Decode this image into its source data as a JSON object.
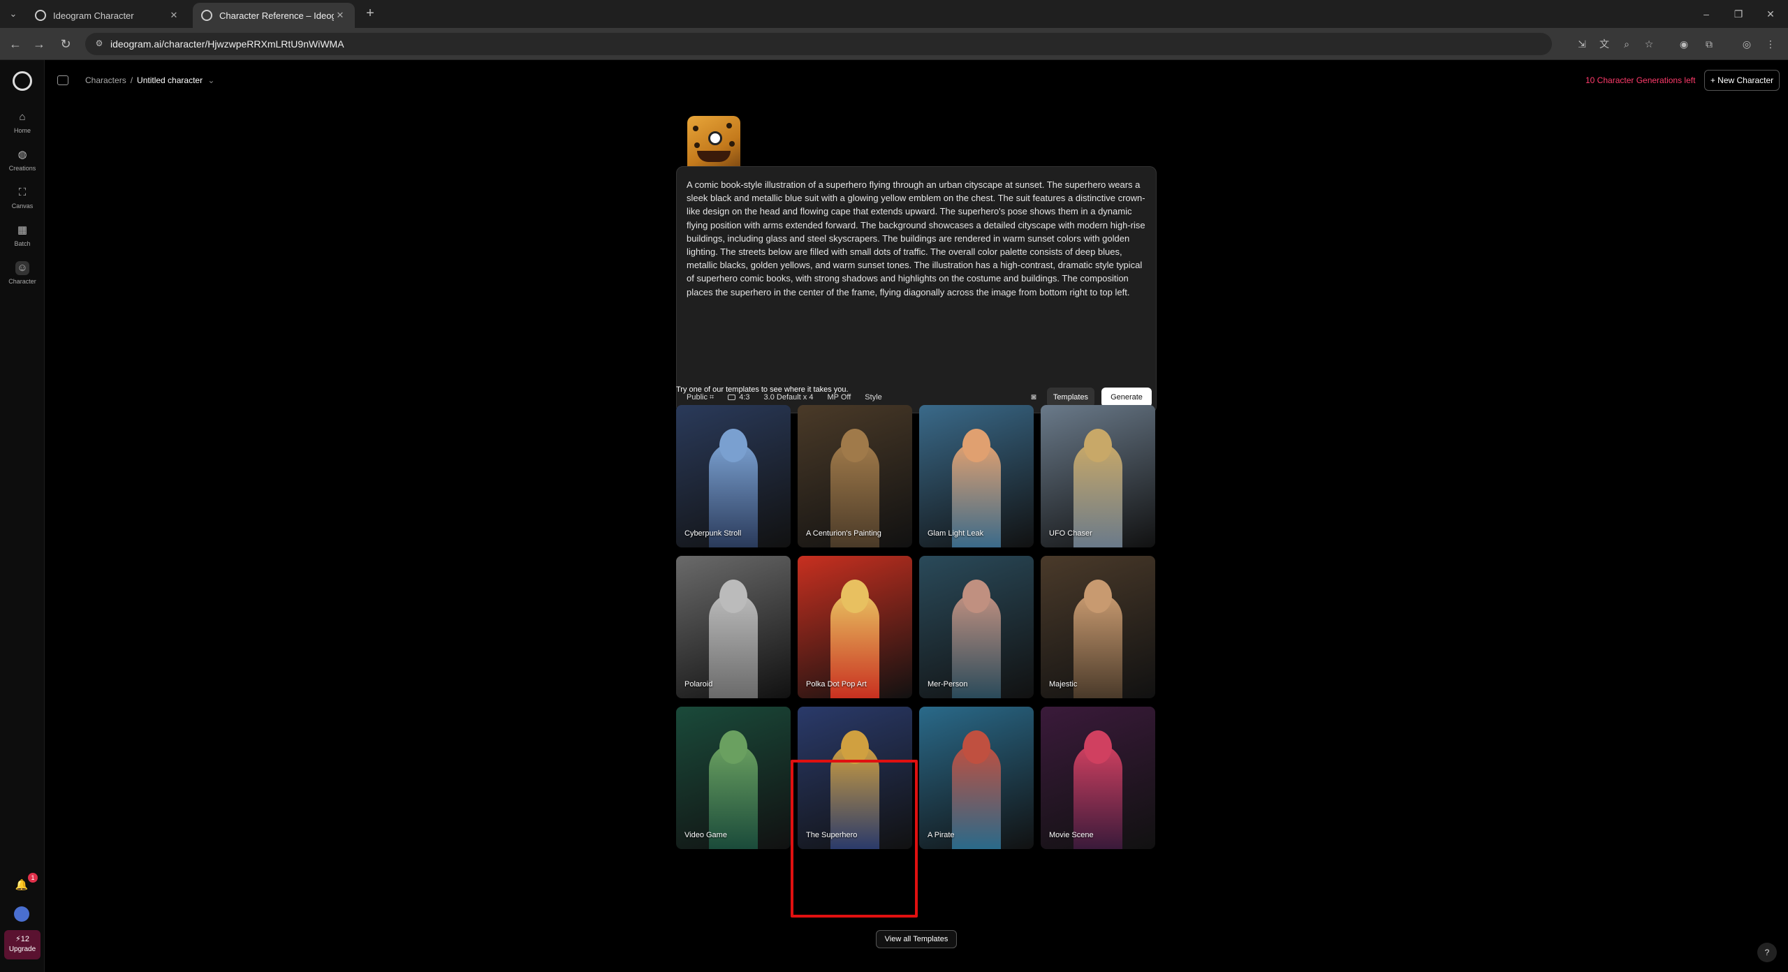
{
  "browser": {
    "tabs": [
      {
        "title": "Ideogram Character",
        "active": false
      },
      {
        "title": "Character Reference – Ideogr…",
        "active": true
      }
    ],
    "url": "ideogram.ai/character/HjwzwpeRRXmLRtU9nWiWMA"
  },
  "sidebar": {
    "items": [
      {
        "label": "Home",
        "icon": "home-icon"
      },
      {
        "label": "Creations",
        "icon": "creations-icon"
      },
      {
        "label": "Canvas",
        "icon": "canvas-icon"
      },
      {
        "label": "Batch",
        "icon": "batch-icon"
      },
      {
        "label": "Character",
        "icon": "character-icon"
      }
    ],
    "notification_count": "1",
    "credits": "12",
    "upgrade_label": "Upgrade"
  },
  "header": {
    "breadcrumb_root": "Characters",
    "breadcrumb_current": "Untitled character",
    "generations_left": "10 Character Generations left",
    "new_character": "+ New Character"
  },
  "prompt": {
    "text": "A comic book-style illustration of a superhero flying through an urban cityscape at sunset. The superhero wears a sleek black and metallic blue suit with a glowing yellow emblem on the chest. The suit features a distinctive crown-like design on the head and flowing cape that extends upward. The superhero's pose shows them in a dynamic flying position with arms extended forward. The background showcases a detailed cityscape with modern high-rise buildings, including glass and steel skyscrapers. The buildings are rendered in warm sunset colors with golden lighting. The streets below are filled with small dots of traffic. The overall color palette consists of deep blues, metallic blacks, golden yellows, and warm sunset tones. The illustration has a high-contrast, dramatic style typical of superhero comic books, with strong shadows and highlights on the costume and buildings. The composition places the superhero in the center of the frame, flying diagonally across the image from bottom right to top left.",
    "options": {
      "visibility": "Public",
      "aspect": "4:3",
      "model": "3.0 Default x 4",
      "mp": "MP Off",
      "style": "Style"
    },
    "templates_label": "Templates",
    "generate_label": "Generate"
  },
  "templates_intro": "Try one of our templates to see where it takes you.",
  "templates": [
    {
      "label": "Cyberpunk Stroll",
      "bg": "#2a3a5a",
      "accent": "#7aa0d0"
    },
    {
      "label": "A Centurion's Painting",
      "bg": "#4a3a28",
      "accent": "#a07a4a"
    },
    {
      "label": "Glam Light Leak",
      "bg": "#3a6a8a",
      "accent": "#e0a070"
    },
    {
      "label": "UFO Chaser",
      "bg": "#6a7a8a",
      "accent": "#c8a868"
    },
    {
      "label": "Polaroid",
      "bg": "#6a6a6a",
      "accent": "#bbbbbb"
    },
    {
      "label": "Polka Dot Pop Art",
      "bg": "#c83020",
      "accent": "#e8c060"
    },
    {
      "label": "Mer-Person",
      "bg": "#2a4a5a",
      "accent": "#c09080"
    },
    {
      "label": "Majestic",
      "bg": "#4a3a2a",
      "accent": "#c89a70"
    },
    {
      "label": "Video Game",
      "bg": "#1a4a3a",
      "accent": "#6aa060"
    },
    {
      "label": "The Superhero",
      "bg": "#2a3a6a",
      "accent": "#d0a040"
    },
    {
      "label": "A Pirate",
      "bg": "#2a6a8a",
      "accent": "#c05040"
    },
    {
      "label": "Movie Scene",
      "bg": "#3a1a3a",
      "accent": "#d04060"
    }
  ],
  "view_all": "View all Templates",
  "help": "?"
}
